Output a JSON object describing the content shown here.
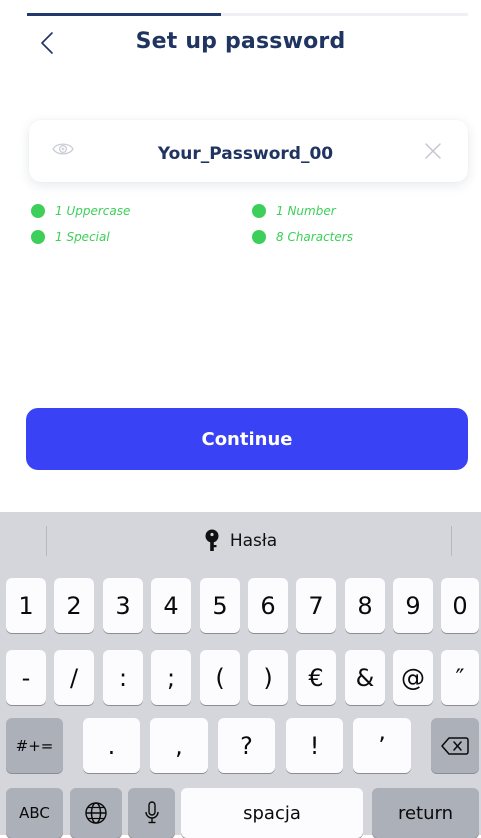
{
  "header": {
    "title": "Set up password",
    "progress": 0.44
  },
  "password_field": {
    "value": "Your_Password_00",
    "show_icon": "eye-icon",
    "clear_icon": "close-icon"
  },
  "requirements": [
    {
      "label": "1 Uppercase",
      "met": true
    },
    {
      "label": "1 Number",
      "met": true
    },
    {
      "label": "1 Special",
      "met": true
    },
    {
      "label": "8 Characters",
      "met": true
    }
  ],
  "continue_label": "Continue",
  "colors": {
    "primary": "#3a42f5",
    "title": "#1f3460",
    "requirement_ok": "#3ecf5a"
  },
  "keyboard": {
    "suggestion": {
      "icon": "key-icon",
      "label": "Hasła"
    },
    "row1": [
      "1",
      "2",
      "3",
      "4",
      "5",
      "6",
      "7",
      "8",
      "9",
      "0"
    ],
    "row2": [
      "-",
      "/",
      ":",
      ";",
      "(",
      ")",
      "€",
      "&",
      "@",
      "″"
    ],
    "row3": {
      "shift_label": "#+=",
      "keys": [
        ".",
        ",",
        "?",
        "!",
        "’"
      ],
      "backspace_icon": "backspace-icon"
    },
    "row4": {
      "abc_label": "ABC",
      "globe_icon": "globe-icon",
      "mic_icon": "microphone-icon",
      "space_label": "spacja",
      "return_label": "return"
    }
  }
}
